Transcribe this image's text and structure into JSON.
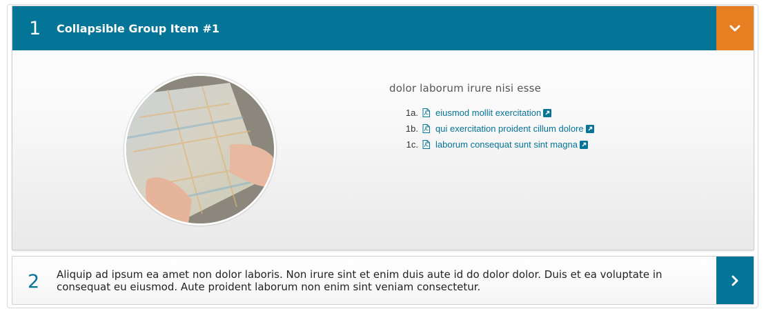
{
  "accordion": {
    "items": [
      {
        "number": "1",
        "title": "Collapsible Group Item #1",
        "expanded": true,
        "toggle_icon": "chevron-down-icon",
        "content": {
          "image": "map-photo",
          "heading": "dolor laborum irure nisi esse",
          "links": [
            {
              "marker": "1a.",
              "text": "eiusmod mollit exercitation",
              "file_icon": "pdf-icon",
              "ext_icon": "external-link-icon"
            },
            {
              "marker": "1b.",
              "text": "qui exercitation proident cillum dolore",
              "file_icon": "pdf-icon",
              "ext_icon": "external-link-icon"
            },
            {
              "marker": "1c.",
              "text": "laborum consequat sunt sint magna",
              "file_icon": "pdf-icon",
              "ext_icon": "external-link-icon"
            }
          ]
        }
      },
      {
        "number": "2",
        "title": "Aliquip ad ipsum ea amet non dolor laboris. Non irure sint et enim duis aute id do dolor dolor. Duis et ea voluptate in consequat eu eiusmod. Aute proident laborum non enim sint veniam consectetur.",
        "expanded": false,
        "toggle_icon": "chevron-right-icon"
      }
    ]
  },
  "colors": {
    "header_blue": "#047497",
    "toggle_orange": "#e67e22",
    "link_blue": "#047497"
  }
}
